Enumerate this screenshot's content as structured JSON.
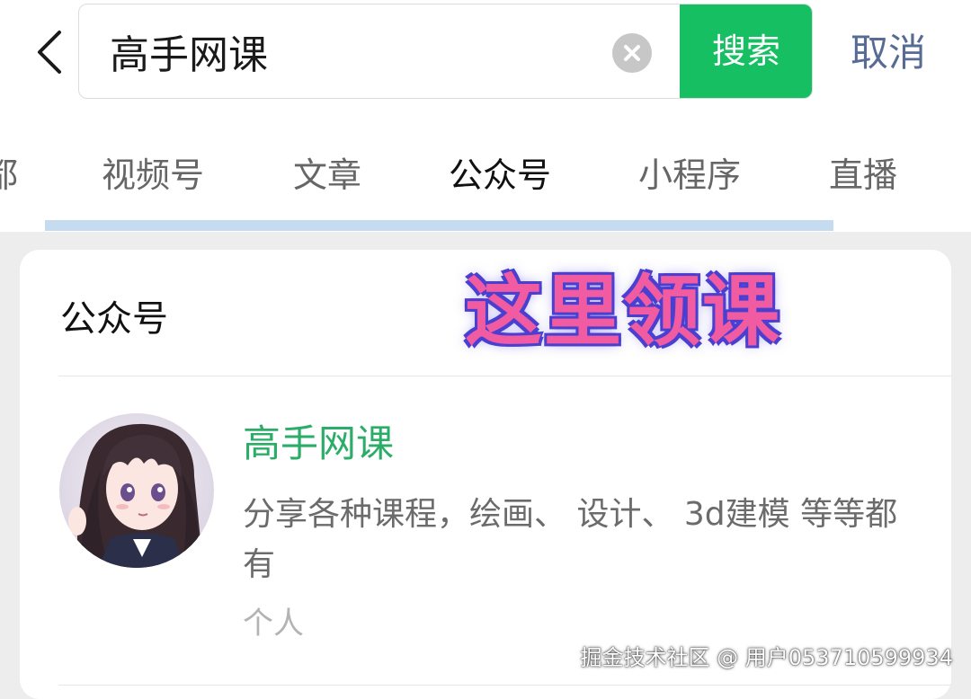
{
  "search": {
    "query": "高手网课",
    "search_button_label": "搜索",
    "cancel_label": "取消"
  },
  "tabs": [
    {
      "label": "都",
      "active": false
    },
    {
      "label": "视频号",
      "active": false
    },
    {
      "label": "文章",
      "active": false
    },
    {
      "label": "公众号",
      "active": true
    },
    {
      "label": "小程序",
      "active": false
    },
    {
      "label": "直播",
      "active": false
    }
  ],
  "section": {
    "title": "公众号",
    "promo_text": "这里领课"
  },
  "result": {
    "name": "高手网课",
    "description": "分享各种课程，绘画、 设计、 3d建模 等等都有",
    "type": "个人",
    "avatar_icon": "anime-girl-avatar"
  },
  "watermark": "掘金技术社区 @ 用户053710599934",
  "colors": {
    "accent_green": "#16c062",
    "name_green": "#2aae67",
    "link_blue": "#576b95",
    "promo_pink": "#f05ba2",
    "promo_outline": "#4a3fd0",
    "tab_underline": "#c4dbf0"
  }
}
